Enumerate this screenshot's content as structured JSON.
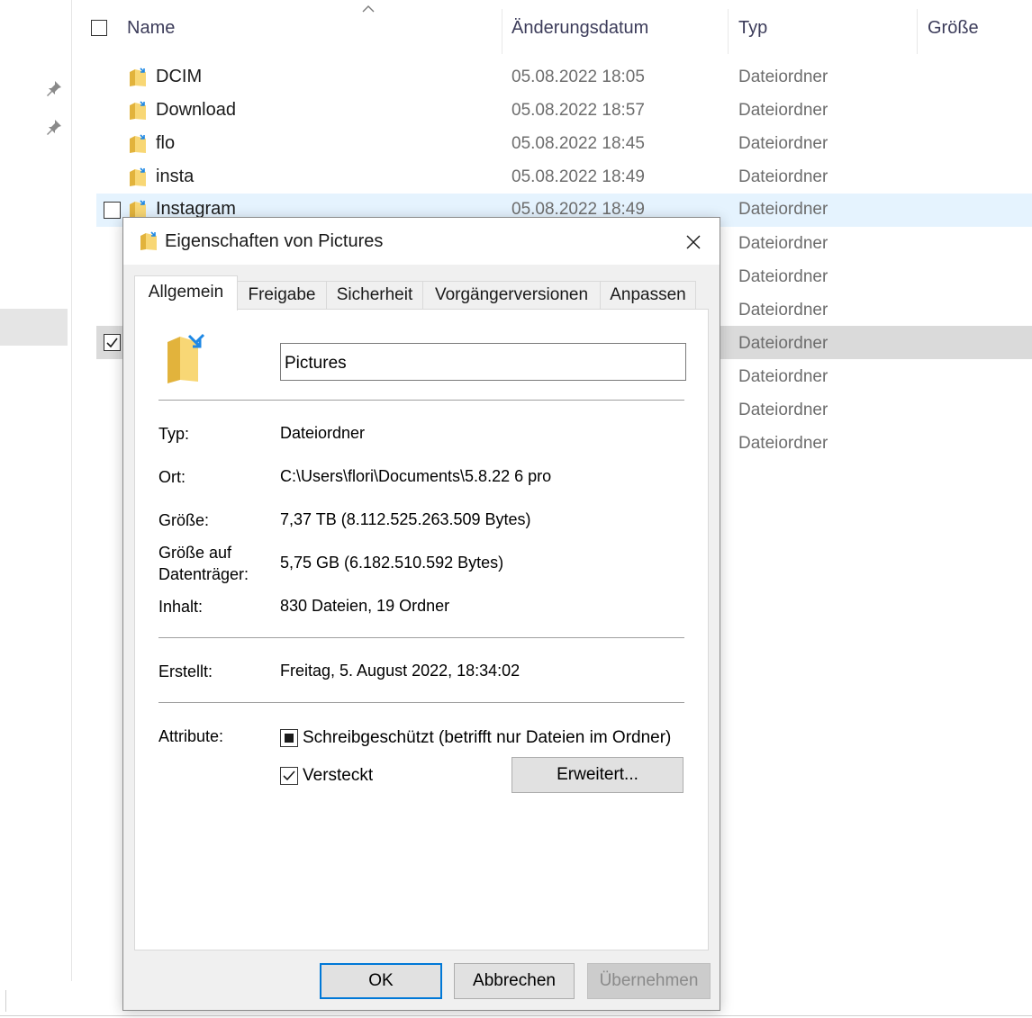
{
  "explorer": {
    "columns": {
      "name": "Name",
      "date": "Änderungsdatum",
      "type": "Typ",
      "size": "Größe"
    },
    "rows": [
      {
        "name": "DCIM",
        "date": "05.08.2022 18:05",
        "type": "Dateiordner"
      },
      {
        "name": "Download",
        "date": "05.08.2022 18:57",
        "type": "Dateiordner"
      },
      {
        "name": "flo",
        "date": "05.08.2022 18:45",
        "type": "Dateiordner"
      },
      {
        "name": "insta",
        "date": "05.08.2022 18:49",
        "type": "Dateiordner"
      },
      {
        "name": "Instagram",
        "date": "05.08.2022 18:49",
        "type": "Dateiordner"
      },
      {
        "name": "",
        "date": "",
        "type": "Dateiordner"
      },
      {
        "name": "",
        "date": "",
        "type": "Dateiordner"
      },
      {
        "name": "",
        "date": "",
        "type": "Dateiordner"
      },
      {
        "name": "",
        "date": "",
        "type": "Dateiordner"
      },
      {
        "name": "",
        "date": "",
        "type": "Dateiordner"
      },
      {
        "name": "",
        "date": "",
        "type": "Dateiordner"
      },
      {
        "name": "",
        "date": "",
        "type": "Dateiordner"
      }
    ]
  },
  "dialog": {
    "title": "Eigenschaften von Pictures",
    "tabs": [
      "Allgemein",
      "Freigabe",
      "Sicherheit",
      "Vorgängerversionen",
      "Anpassen"
    ],
    "active_tab": "Allgemein",
    "folder_name": "Pictures",
    "fields": {
      "type_label": "Typ:",
      "type_value": "Dateiordner",
      "location_label": "Ort:",
      "location_value": "C:\\Users\\flori\\Documents\\5.8.22 6 pro",
      "size_label": "Größe:",
      "size_value": "7,37 TB (8.112.525.263.509 Bytes)",
      "size_on_disk_label_1": "Größe auf",
      "size_on_disk_label_2": "Datenträger:",
      "size_on_disk_value": "5,75 GB (6.182.510.592 Bytes)",
      "contents_label": "Inhalt:",
      "contents_value": "830 Dateien, 19 Ordner",
      "created_label": "Erstellt:",
      "created_value": "Freitag, 5. August 2022, 18:34:02",
      "attributes_label": "Attribute:"
    },
    "attributes": {
      "readonly_label": "Schreibgeschützt (betrifft nur Dateien im Ordner)",
      "readonly_state": "indeterminate",
      "hidden_label": "Versteckt",
      "hidden_state": "checked",
      "advanced_button": "Erweitert..."
    },
    "buttons": {
      "ok": "OK",
      "cancel": "Abbrechen",
      "apply": "Übernehmen"
    }
  },
  "colors": {
    "folder_yellow": "#f8d775",
    "folder_dark": "#e2b33c",
    "share_arrow": "#1e88e5",
    "accent_blue": "#0078d7",
    "hover_row": "#e5f3fe",
    "selected_row": "#dadada"
  },
  "icons": {
    "pin": "pin-icon",
    "folder": "folder-icon",
    "close": "close-icon",
    "sort": "sort-caret-icon"
  }
}
